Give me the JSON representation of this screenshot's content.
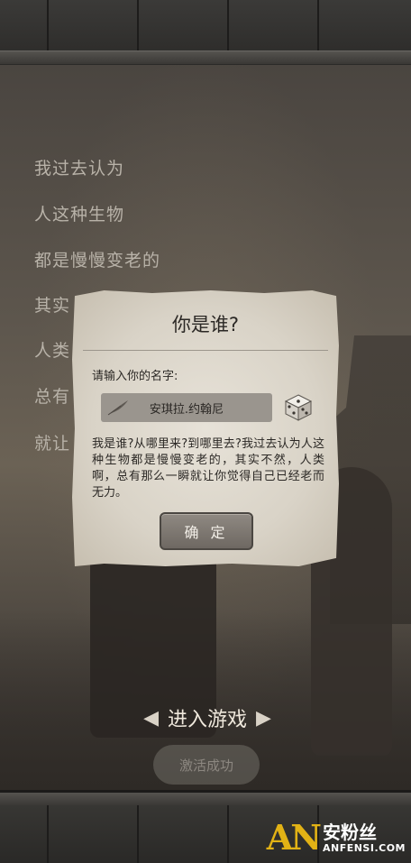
{
  "poem": {
    "lines": [
      "我过去认为",
      "人这种生物",
      "都是慢慢变老的",
      "其实",
      "人类",
      "总有",
      "就让"
    ]
  },
  "dialog": {
    "title": "你是谁?",
    "prompt": "请输入你的名字:",
    "name_value": "安琪拉.约翰尼",
    "description": "我是谁?从哪里来?到哪里去?我过去认为人这种生物都是慢慢变老的，其实不然，人类啊，总有那么一瞬就让你觉得自己已经老而无力。",
    "confirm_label": "确 定"
  },
  "bottom": {
    "enter_game_label": "进入游戏",
    "activate_label": "激活成功"
  },
  "watermark": {
    "logo": "AN",
    "cn": "安粉丝",
    "en": "ANFENSI.COM"
  },
  "icons": {
    "quill": "quill-icon",
    "dice": "dice-icon",
    "arrow_left": "arrow-left-icon",
    "arrow_right": "arrow-right-icon"
  },
  "colors": {
    "watermark_gold": "#e2b215",
    "paper": "#d9d3c7",
    "button_wood": "#7d7770"
  }
}
